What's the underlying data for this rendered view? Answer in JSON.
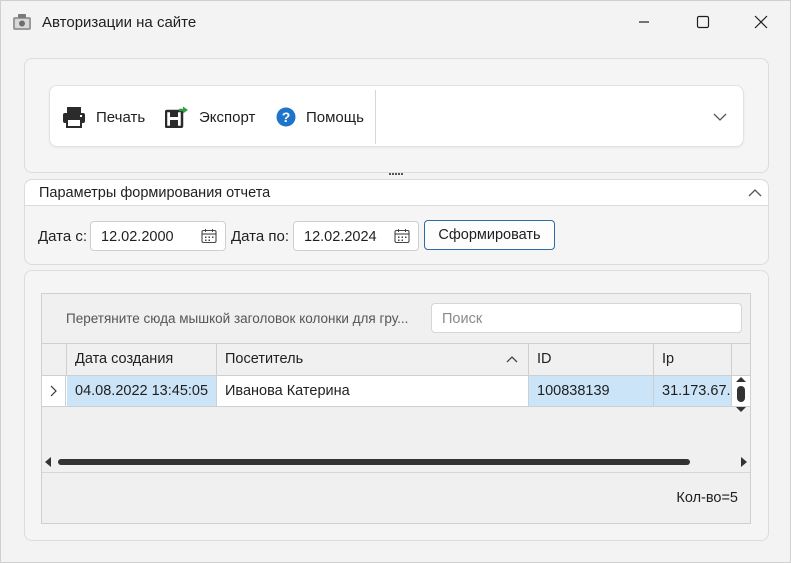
{
  "window": {
    "title": "Авторизации на сайте"
  },
  "toolbar": {
    "print_label": "Печать",
    "export_label": "Экспорт",
    "help_label": "Помощь"
  },
  "params": {
    "title": "Параметры формирования отчета",
    "date_from_label": "Дата с:",
    "date_from_value": "12.02.2000",
    "date_to_label": "Дата по:",
    "date_to_value": "12.02.2024",
    "generate_label": "Сформировать"
  },
  "grid": {
    "group_hint": "Перетяните сюда мышкой заголовок колонки для гру...",
    "search_placeholder": "Поиск",
    "columns": [
      "Дата создания",
      "Посетитель",
      "ID",
      "Ip"
    ],
    "rows": [
      [
        "04.08.2022 13:45:05",
        "Иванова Катерина",
        "100838139",
        "31.173.67."
      ]
    ],
    "count_text": "Кол-во=5"
  }
}
